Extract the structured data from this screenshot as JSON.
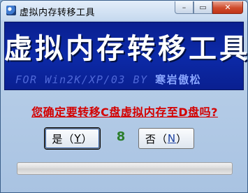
{
  "window": {
    "title": "虚拟内存转移工具",
    "min_glyph": "–",
    "max_glyph": "▭",
    "close_glyph": "✕"
  },
  "banner": {
    "title": "虚拟内存转移工具",
    "subtitle": "FOR Win2K/XP/03 BY ",
    "author": "寒岩傲松"
  },
  "question": "您确定要转移C盘虚拟内存至D盘吗?",
  "buttons": {
    "yes": {
      "label": "是（",
      "hotkey": "Y",
      "suffix": "）"
    },
    "no": {
      "label": "否（",
      "hotkey": "N",
      "suffix": "）"
    }
  },
  "countdown": "8",
  "progress": {
    "value": 0
  },
  "colors": {
    "banner_bg": "#0c2aa8",
    "question_text": "#d40000",
    "countdown_text": "#2b7d2b"
  }
}
